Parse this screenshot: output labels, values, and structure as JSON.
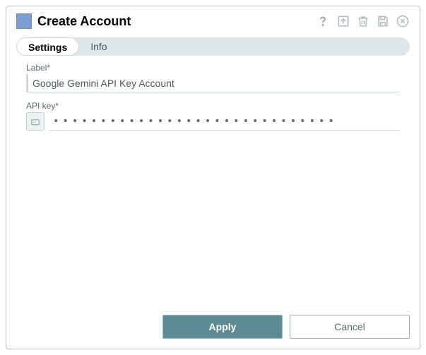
{
  "header": {
    "title": "Create Account"
  },
  "tabs": {
    "settings": "Settings",
    "info": "Info"
  },
  "form": {
    "label_field_label": "Label*",
    "label_value": "Google Gemini API Key Account",
    "apikey_field_label": "API key*",
    "apikey_masked": "••••••••••••••••••••••••••••••"
  },
  "footer": {
    "apply": "Apply",
    "cancel": "Cancel"
  }
}
